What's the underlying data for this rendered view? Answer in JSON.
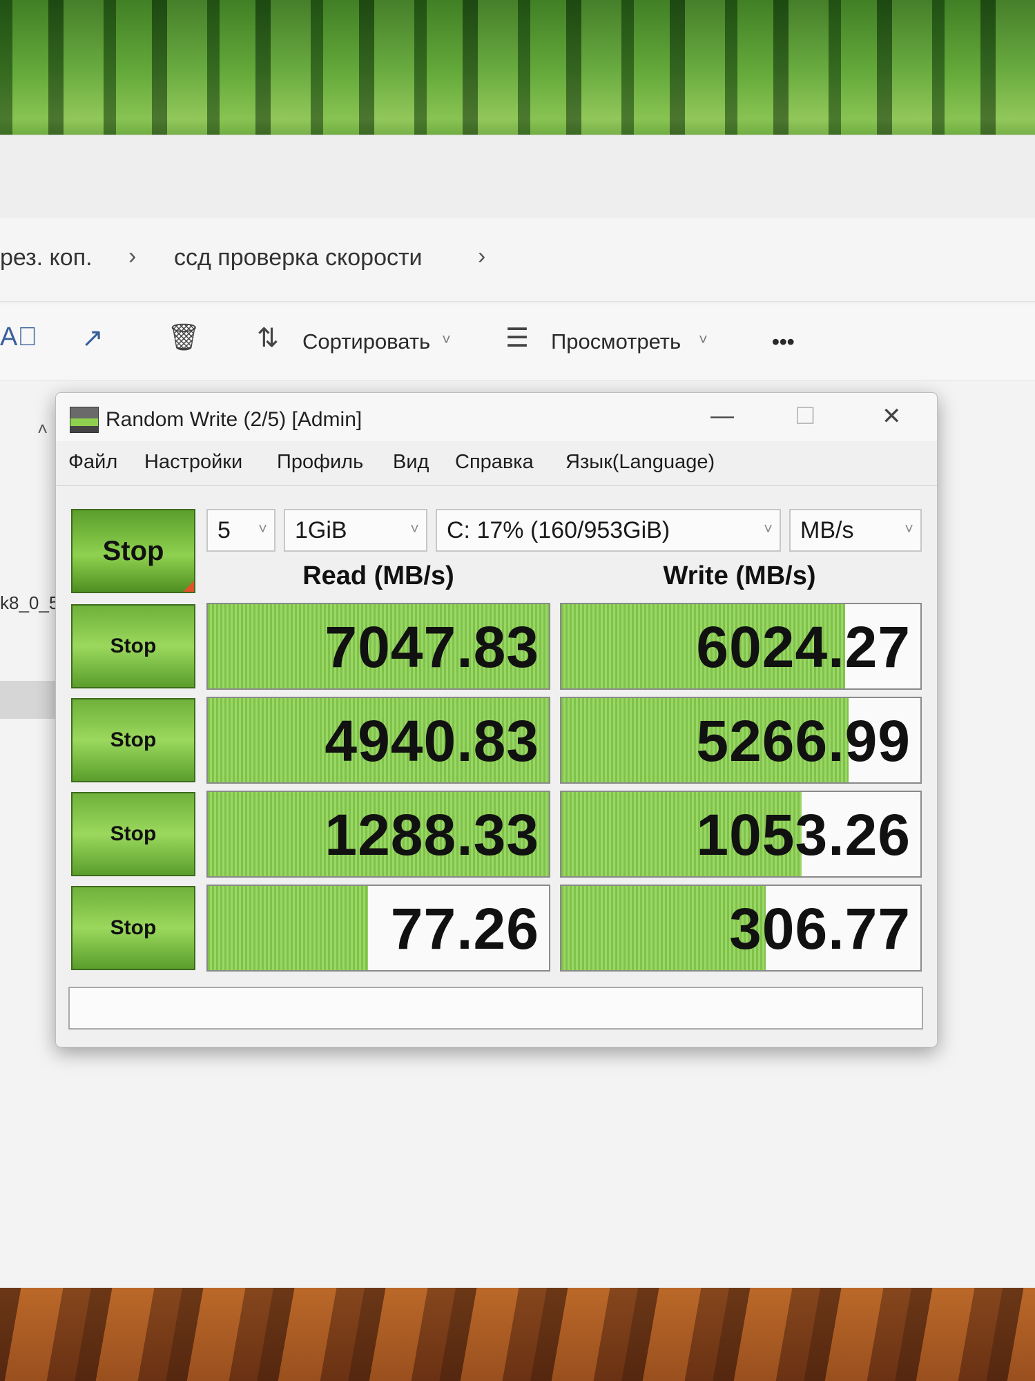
{
  "explorer": {
    "breadcrumb": [
      "рез. коп.",
      "ссд проверка скорости"
    ],
    "toolbar": {
      "sort_label": "Сортировать",
      "view_label": "Просмотреть",
      "more_label": "•••"
    },
    "side_file_fragment": "k8_0_5"
  },
  "cdm": {
    "title": "Random Write (2/5) [Admin]",
    "menu": [
      "Файл",
      "Настройки",
      "Профиль",
      "Вид",
      "Справка",
      "Язык(Language)"
    ],
    "all_button": "Stop",
    "count": "5",
    "size": "1GiB",
    "drive": "C: 17% (160/953GiB)",
    "unit": "MB/s",
    "read_header": "Read (MB/s)",
    "write_header": "Write (MB/s)",
    "rows": [
      {
        "button": "Stop",
        "read": "7047.83",
        "write": "6024.27",
        "read_fill": 1.0,
        "write_fill": 0.79
      },
      {
        "button": "Stop",
        "read": "4940.83",
        "write": "5266.99",
        "read_fill": 1.0,
        "write_fill": 0.8
      },
      {
        "button": "Stop",
        "read": "1288.33",
        "write": "1053.26",
        "read_fill": 1.0,
        "write_fill": 0.67
      },
      {
        "button": "Stop",
        "read": "77.26",
        "write": "306.77",
        "read_fill": 0.47,
        "write_fill": 0.57
      }
    ],
    "status": ""
  },
  "colors": {
    "bar_green": "#8fd14f",
    "button_green": "#6fb13b"
  }
}
